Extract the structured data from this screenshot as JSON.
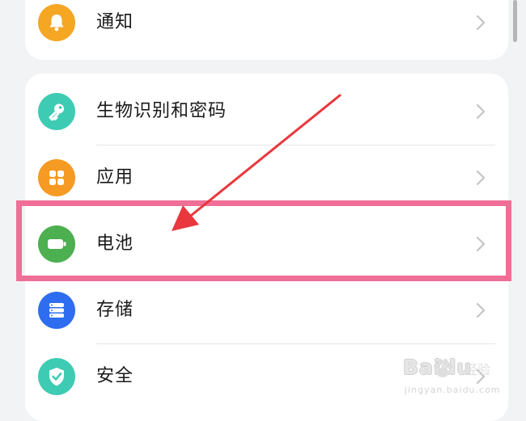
{
  "settings": {
    "items": [
      {
        "label": "通知",
        "icon": "bell-icon",
        "color": "#f5a623"
      },
      {
        "label": "生物识别和密码",
        "icon": "key-icon",
        "color": "#3ecbb3"
      },
      {
        "label": "应用",
        "icon": "apps-grid-icon",
        "color": "#f59a23"
      },
      {
        "label": "电池",
        "icon": "battery-icon",
        "color": "#4caf50"
      },
      {
        "label": "存储",
        "icon": "storage-icon",
        "color": "#2f6df0"
      },
      {
        "label": "安全",
        "icon": "shield-check-icon",
        "color": "#3ecbb3"
      }
    ],
    "highlighted_item": "电池"
  },
  "annotation": {
    "highlight_color": "#ef6f97",
    "arrow_color": "#e8383d"
  },
  "watermark": {
    "brand": "Baidu",
    "brand_cn": "经验",
    "url": "jingyan.baidu.com"
  }
}
